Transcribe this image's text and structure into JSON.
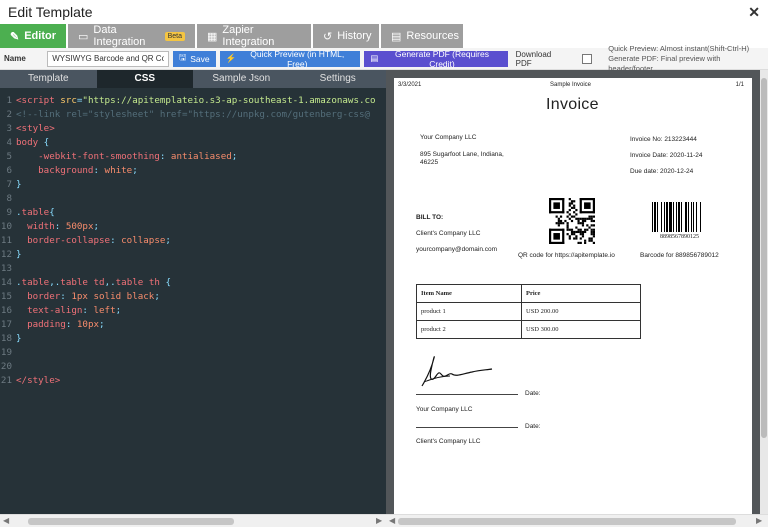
{
  "window": {
    "title": "Edit Template",
    "close": "✕"
  },
  "tabs": [
    {
      "label": "Editor",
      "icon": "✎",
      "icon_name": "pencil-icon",
      "active": true
    },
    {
      "label": "Data Integration",
      "icon": "▭",
      "icon_name": "data-icon",
      "badge": "Beta"
    },
    {
      "label": "Zapier Integration",
      "icon": "▦",
      "icon_name": "grid-icon"
    },
    {
      "label": "History",
      "icon": "↺",
      "icon_name": "history-icon"
    },
    {
      "label": "Resources",
      "icon": "▤",
      "icon_name": "book-icon"
    }
  ],
  "toolbar": {
    "name_label": "Name",
    "name_value": "WYSIWYG Barcode and QR Code S",
    "save_label": "Save",
    "quick_preview_label": "Quick Preview (in HTML, Free)",
    "generate_pdf_label": "Generate PDF (Requires Credit)",
    "download_pdf_label": "Download PDF",
    "hint_line1": "Quick Preview: Almost instant(Shift-Ctrl-H)",
    "hint_line2": "Generate PDF: Final preview with header/footer"
  },
  "editor_tabs": [
    {
      "label": "Template",
      "active": false
    },
    {
      "label": "CSS",
      "active": true
    },
    {
      "label": "Sample Json",
      "active": false
    },
    {
      "label": "Settings",
      "active": false
    }
  ],
  "code_lines": [
    {
      "n": "1",
      "tokens": [
        [
          "tag",
          "<script "
        ],
        [
          "attr",
          "src"
        ],
        [
          "punc",
          "="
        ],
        [
          "str",
          "\"https://apitemplateio.s3-ap-southeast-1.amazonaws.co"
        ]
      ]
    },
    {
      "n": "2",
      "tokens": [
        [
          "comment",
          "<!--link rel=\"stylesheet\" href=\"https://unpkg.com/gutenberg-css@"
        ]
      ]
    },
    {
      "n": "3",
      "tokens": [
        [
          "tag",
          "<style>"
        ]
      ]
    },
    {
      "n": "4",
      "tokens": [
        [
          "sel",
          "body "
        ],
        [
          "punc",
          "{"
        ]
      ]
    },
    {
      "n": "5",
      "tokens": [
        [
          "plain",
          "    "
        ],
        [
          "prop",
          "-webkit-font-smoothing"
        ],
        [
          "punc",
          ": "
        ],
        [
          "val",
          "antialiased"
        ],
        [
          "punc",
          ";"
        ]
      ]
    },
    {
      "n": "6",
      "tokens": [
        [
          "plain",
          "    "
        ],
        [
          "prop",
          "background"
        ],
        [
          "punc",
          ": "
        ],
        [
          "val",
          "white"
        ],
        [
          "punc",
          ";"
        ]
      ]
    },
    {
      "n": "7",
      "tokens": [
        [
          "punc",
          "}"
        ]
      ]
    },
    {
      "n": "8",
      "tokens": []
    },
    {
      "n": "9",
      "tokens": [
        [
          "punc",
          "."
        ],
        [
          "sel",
          "table"
        ],
        [
          "punc",
          "{"
        ]
      ]
    },
    {
      "n": "10",
      "tokens": [
        [
          "plain",
          "  "
        ],
        [
          "prop",
          "width"
        ],
        [
          "punc",
          ": "
        ],
        [
          "val",
          "500px"
        ],
        [
          "punc",
          ";"
        ]
      ]
    },
    {
      "n": "11",
      "tokens": [
        [
          "plain",
          "  "
        ],
        [
          "prop",
          "border-collapse"
        ],
        [
          "punc",
          ": "
        ],
        [
          "val",
          "collapse"
        ],
        [
          "punc",
          ";"
        ]
      ]
    },
    {
      "n": "12",
      "tokens": [
        [
          "punc",
          "}"
        ]
      ]
    },
    {
      "n": "13",
      "tokens": []
    },
    {
      "n": "14",
      "tokens": [
        [
          "punc",
          "."
        ],
        [
          "sel",
          "table"
        ],
        [
          "punc",
          ",."
        ],
        [
          "sel",
          "table td"
        ],
        [
          "punc",
          ",."
        ],
        [
          "sel",
          "table th "
        ],
        [
          "punc",
          "{"
        ]
      ]
    },
    {
      "n": "15",
      "tokens": [
        [
          "plain",
          "  "
        ],
        [
          "prop",
          "border"
        ],
        [
          "punc",
          ": "
        ],
        [
          "val",
          "1px solid black"
        ],
        [
          "punc",
          ";"
        ]
      ]
    },
    {
      "n": "16",
      "tokens": [
        [
          "plain",
          "  "
        ],
        [
          "prop",
          "text-align"
        ],
        [
          "punc",
          ": "
        ],
        [
          "val",
          "left"
        ],
        [
          "punc",
          ";"
        ]
      ]
    },
    {
      "n": "17",
      "tokens": [
        [
          "plain",
          "  "
        ],
        [
          "prop",
          "padding"
        ],
        [
          "punc",
          ": "
        ],
        [
          "val",
          "10px"
        ],
        [
          "punc",
          ";"
        ]
      ]
    },
    {
      "n": "18",
      "tokens": [
        [
          "punc",
          "}"
        ]
      ]
    },
    {
      "n": "19",
      "tokens": []
    },
    {
      "n": "20",
      "tokens": []
    },
    {
      "n": "21",
      "tokens": [
        [
          "tag",
          "</style>"
        ]
      ]
    }
  ],
  "invoice": {
    "date": "3/3/2021",
    "doc_title": "Sample Invoice",
    "page_num": "1/1",
    "heading": "Invoice",
    "company": "Your Company LLC",
    "address1": "895 Sugarfoot Lane, Indiana,",
    "address2": "46225",
    "invoice_no": "Invoice No: 213223444",
    "invoice_date": "Invoice Date: 2020-11-24",
    "due_date": "Due date: 2020-12-24",
    "bill_to_label": "BILL TO:",
    "client": "Client's Company LLC",
    "email": "yourcompany@domain.com",
    "qr_caption": "QR code for https://apitemplate.io",
    "barcode_number": "8898567890125",
    "barcode_caption": "Barcode for 889856789012",
    "table_headers": [
      "Item Name",
      "Price"
    ],
    "table_rows": [
      [
        "product 1",
        "USD 200.00"
      ],
      [
        "product 2",
        "USD 300.00"
      ]
    ],
    "date_label": "Date:",
    "signer1": "Your Company LLC",
    "signer2": "Client's Company LLC"
  }
}
